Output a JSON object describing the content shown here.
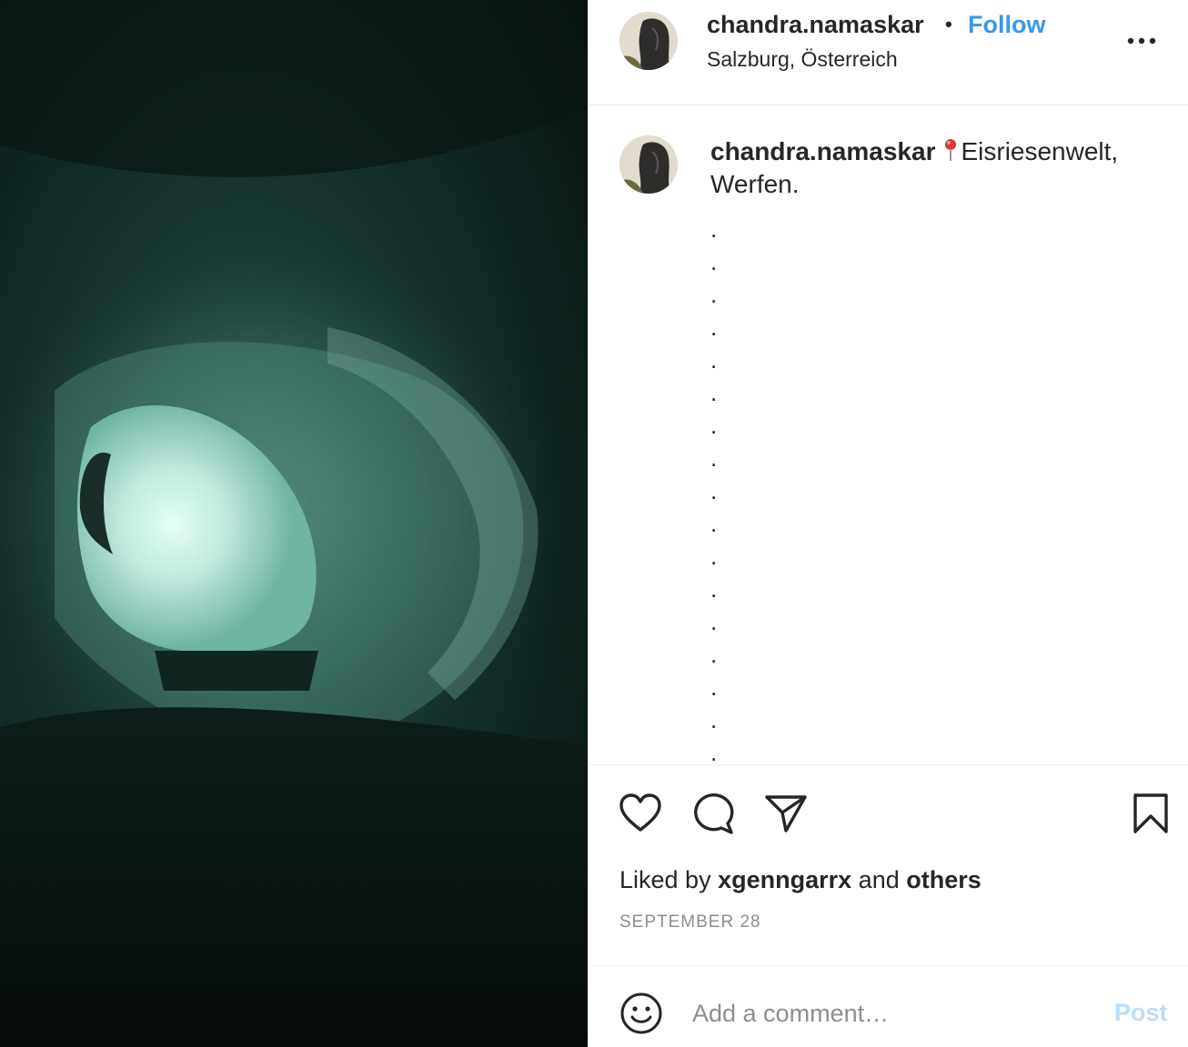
{
  "post": {
    "image_description_icon": "ice-cave-photo",
    "header": {
      "username": "chandra.namaskar",
      "separator": "•",
      "follow_label": "Follow",
      "location": "Salzburg, Österreich",
      "more_icon": "more-options-icon"
    },
    "caption": {
      "username": "chandra.namaskar",
      "location_pin_icon": "round-pushpin-icon",
      "text": "Eisriesenwelt, Werfen.",
      "dots": [
        ".",
        ".",
        ".",
        ".",
        ".",
        ".",
        ".",
        ".",
        ".",
        ".",
        ".",
        ".",
        ".",
        ".",
        ".",
        ".",
        "."
      ]
    },
    "actions": {
      "like_icon": "heart-icon",
      "comment_icon": "comment-bubble-icon",
      "share_icon": "paper-plane-icon",
      "save_icon": "bookmark-icon"
    },
    "likes": {
      "prefix": "Liked by",
      "user": "xgenngarrx",
      "conjunction": "and",
      "others": "others"
    },
    "date": "SEPTEMBER 28",
    "comment_box": {
      "emoji_icon": "smiley-face-icon",
      "placeholder": "Add a comment…",
      "post_label": "Post"
    }
  },
  "colors": {
    "link_blue": "#3897f0",
    "post_disabled": "#b9dcfb",
    "text": "#262626",
    "muted": "#8e8e8e",
    "divider": "#efefef"
  }
}
